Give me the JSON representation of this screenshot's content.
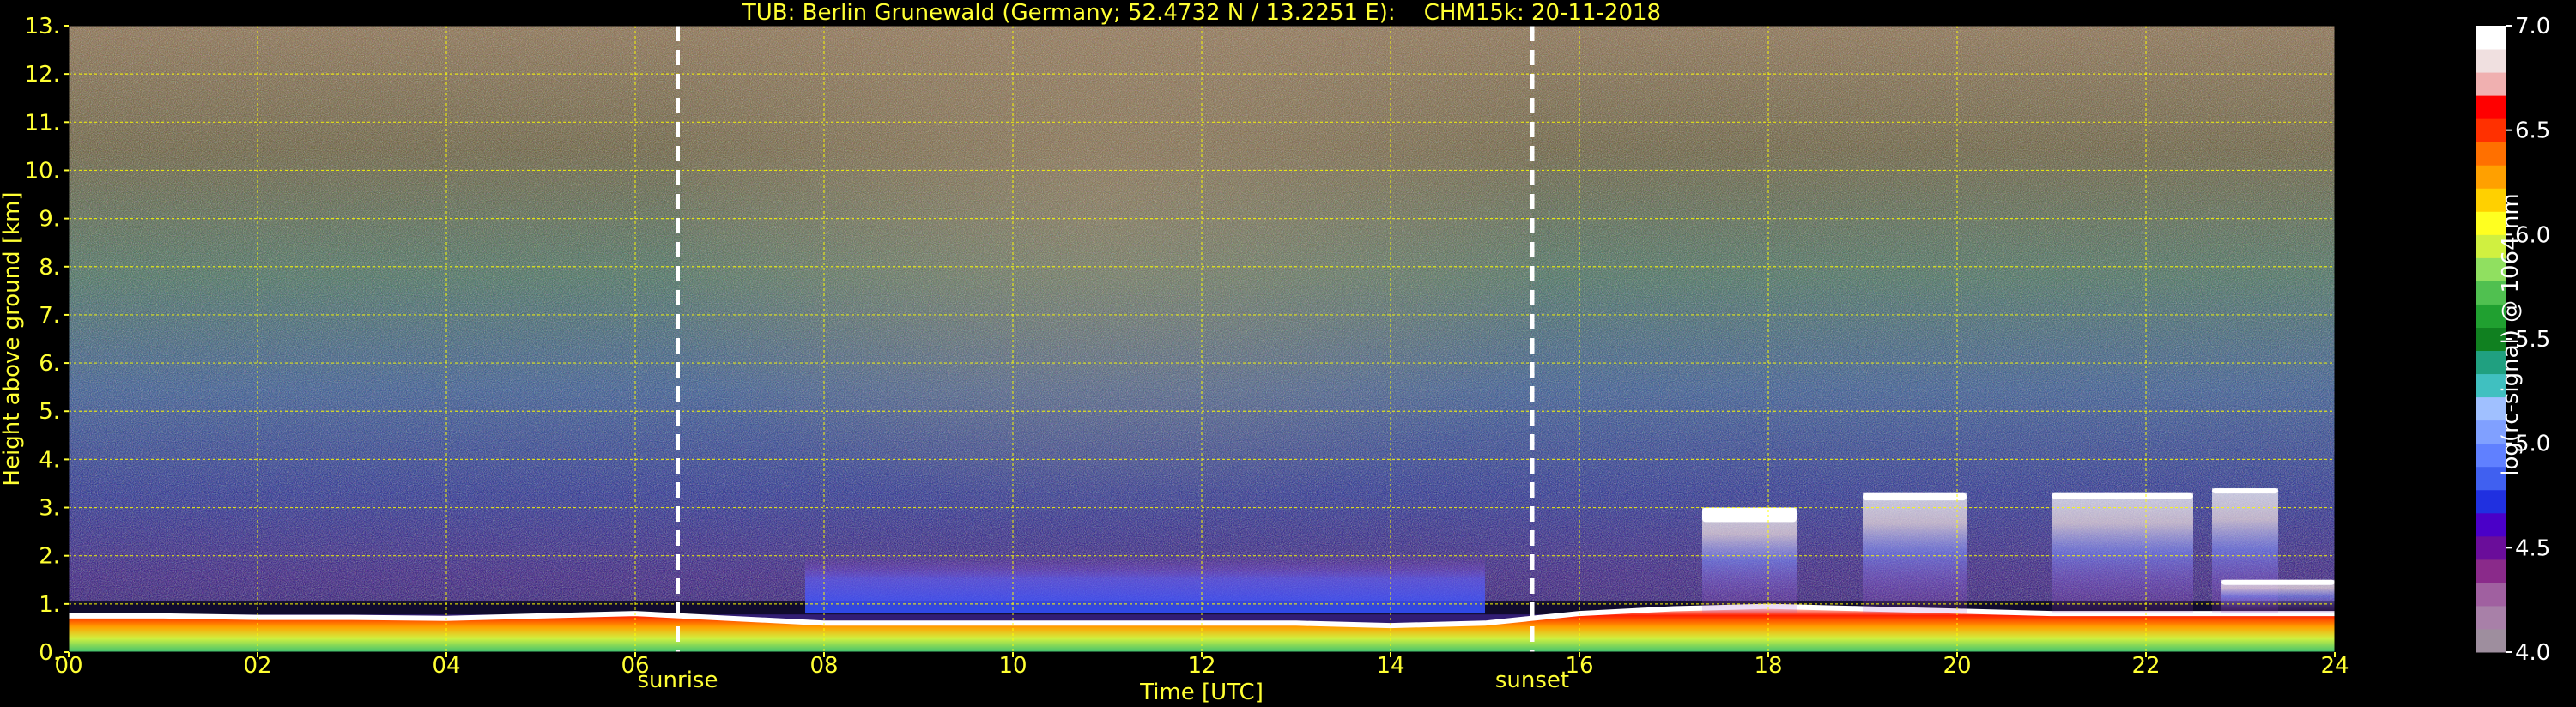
{
  "chart_data": {
    "type": "heatmap",
    "title": "TUB: Berlin Grunewald (Germany; 52.4732 N / 13.2251 E):    CHM15k: 20-11-2018",
    "xlabel": "Time [UTC]",
    "ylabel": "Height above ground [km]",
    "xlim": [
      0,
      24
    ],
    "ylim": [
      0,
      13
    ],
    "x_ticks": [
      "00",
      "02",
      "04",
      "06",
      "08",
      "10",
      "12",
      "14",
      "16",
      "18",
      "20",
      "22",
      "24"
    ],
    "y_ticks": [
      "0.",
      "1.",
      "2.",
      "3.",
      "4.",
      "5.",
      "6.",
      "7.",
      "8.",
      "9.",
      "10.",
      "11.",
      "12.",
      "13."
    ],
    "grid": true,
    "markers": [
      {
        "label": "sunrise",
        "x": 6.45
      },
      {
        "label": "sunset",
        "x": 15.5
      }
    ],
    "colorbar": {
      "label": "log(rc-signal) @ 1064 nm",
      "range": [
        4.0,
        7.0
      ],
      "ticks": [
        "4.0",
        "4.5",
        "5.0",
        "5.5",
        "6.0",
        "6.5",
        "7.0"
      ],
      "colors": [
        "#9e8e9e",
        "#a880a8",
        "#a060a0",
        "#8a2a8a",
        "#6a0d9a",
        "#4a00c8",
        "#2030e0",
        "#4060f0",
        "#6080ff",
        "#80a0ff",
        "#a0c0ff",
        "#40c0c0",
        "#20a080",
        "#108020",
        "#20a030",
        "#50c050",
        "#90e060",
        "#d0f040",
        "#ffff20",
        "#ffd000",
        "#ffa000",
        "#ff7000",
        "#ff3000",
        "#ff0000",
        "#f0b0b0",
        "#f0e0e0",
        "#ffffff"
      ]
    },
    "description_layers": {
      "boundary_layer_top_km": [
        0.75,
        0.75,
        0.72,
        0.72,
        0.7,
        0.75,
        0.8,
        0.7,
        0.6,
        0.6,
        0.6,
        0.6,
        0.6,
        0.6,
        0.55,
        0.6,
        0.8,
        0.9,
        0.95,
        0.9,
        0.85,
        0.8,
        0.8,
        0.8,
        0.8
      ]
    },
    "clouds": [
      {
        "x_start": 17.3,
        "x_end": 18.3,
        "base_km": 2.0,
        "top_km": 3.0
      },
      {
        "x_start": 19.0,
        "x_end": 20.1,
        "base_km": 2.8,
        "top_km": 3.3
      },
      {
        "x_start": 21.0,
        "x_end": 22.5,
        "base_km": 2.9,
        "top_km": 3.3
      },
      {
        "x_start": 22.7,
        "x_end": 23.4,
        "base_km": 3.1,
        "top_km": 3.4
      },
      {
        "x_start": 22.8,
        "x_end": 24.0,
        "base_km": 1.2,
        "top_km": 1.5
      }
    ]
  }
}
